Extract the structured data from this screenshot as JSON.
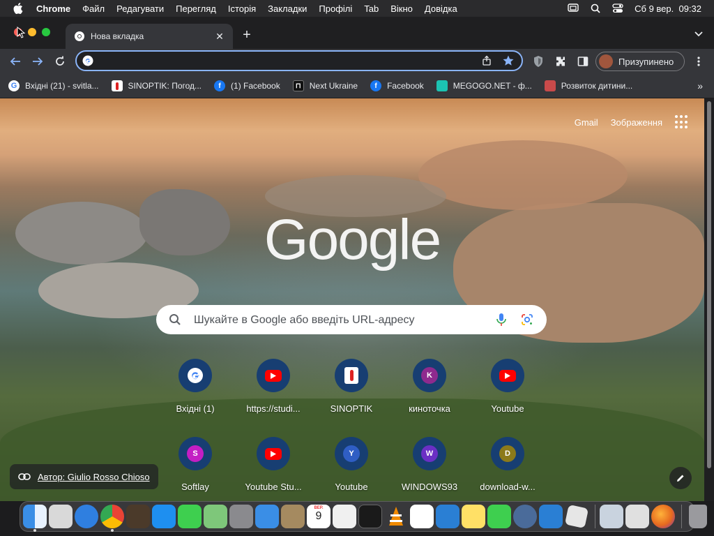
{
  "menubar": {
    "app_name": "Chrome",
    "items": [
      "Файл",
      "Редагувати",
      "Перегляд",
      "Історія",
      "Закладки",
      "Профілі",
      "Tab",
      "Вікно",
      "Довідка"
    ],
    "datetime": "Сб 9 вер.  09:32"
  },
  "tab": {
    "title": "Нова вкладка"
  },
  "omnibox": {
    "value": ""
  },
  "profile": {
    "label": "Призупинено"
  },
  "bookmarks": [
    {
      "label": "Вхідні (21) - svitla...",
      "icon": "google-icon",
      "color": "#ffffff"
    },
    {
      "label": "SINOPTIK: Погод...",
      "icon": "thermometer-icon",
      "color": "#ffffff"
    },
    {
      "label": "(1) Facebook",
      "icon": "facebook-icon",
      "color": "#1877f2"
    },
    {
      "label": "Next Ukraine",
      "icon": "next-ukraine-icon",
      "color": "#111111"
    },
    {
      "label": "Facebook",
      "icon": "facebook-icon",
      "color": "#1877f2"
    },
    {
      "label": "MEGOGO.NET - ф...",
      "icon": "megogo-icon",
      "color": "#1cc3b2"
    },
    {
      "label": "Розвиток дитини...",
      "icon": "child-dev-icon",
      "color": "#c94a4a"
    }
  ],
  "ntp": {
    "top_links": {
      "gmail": "Gmail",
      "images": "Зображення"
    },
    "logo_text": "Google",
    "search_placeholder": "Шукайте в Google або введіть URL-адресу",
    "shortcuts_row1": [
      {
        "label": "Вхідні (1)",
        "icon": "google-icon",
        "letter": ""
      },
      {
        "label": "https://studi...",
        "icon": "youtube-icon",
        "letter": ""
      },
      {
        "label": "SINOPTIK",
        "icon": "thermometer-icon",
        "letter": ""
      },
      {
        "label": "киноточка",
        "icon": "letter-icon",
        "letter": "K",
        "color": "#8e2a8e"
      },
      {
        "label": "Youtube",
        "icon": "youtube-icon",
        "letter": ""
      }
    ],
    "shortcuts_row2": [
      {
        "label": "Softlay",
        "icon": "letter-icon",
        "letter": "S",
        "color": "#c41ec4"
      },
      {
        "label": "Youtube Stu...",
        "icon": "youtube-icon",
        "letter": ""
      },
      {
        "label": "Youtube",
        "icon": "letter-icon",
        "letter": "Y",
        "color": "#2f5ec4"
      },
      {
        "label": "WINDOWS93",
        "icon": "letter-icon",
        "letter": "W",
        "color": "#6b2fc4"
      },
      {
        "label": "download-w...",
        "icon": "letter-icon",
        "letter": "D",
        "color": "#8c7a1a"
      }
    ],
    "author": "Автор: Giulio Rosso Chioso"
  },
  "dock": {
    "apps": [
      {
        "name": "finder-icon",
        "color": "#3a8ee6"
      },
      {
        "name": "launchpad-icon",
        "color": "#d9d9d9"
      },
      {
        "name": "safari-icon",
        "color": "#2f7fe0"
      },
      {
        "name": "chrome-icon",
        "color": "#ffffff"
      },
      {
        "name": "garageband-icon",
        "color": "#4b3a2a"
      },
      {
        "name": "app-store-icon",
        "color": "#1e8ff0"
      },
      {
        "name": "messages-icon",
        "color": "#3ecf4f"
      },
      {
        "name": "maps-icon",
        "color": "#7ec77a"
      },
      {
        "name": "system-settings-icon",
        "color": "#8a8a8e"
      },
      {
        "name": "mail-icon",
        "color": "#3a8ee6"
      },
      {
        "name": "contacts-icon",
        "color": "#a58a60"
      },
      {
        "name": "calendar-icon",
        "color": "#ffffff"
      },
      {
        "name": "textedit-icon",
        "color": "#f0f0f0"
      },
      {
        "name": "terminal-icon",
        "color": "#1a1a1a"
      },
      {
        "name": "vlc-icon",
        "color": "#f08a00"
      },
      {
        "name": "reminders-icon",
        "color": "#ffffff"
      },
      {
        "name": "vscode-icon",
        "color": "#2a7fd4"
      },
      {
        "name": "notes-icon",
        "color": "#ffe066"
      },
      {
        "name": "facetime-icon",
        "color": "#3ecf4f"
      },
      {
        "name": "quicktime-icon",
        "color": "#4a6b9a"
      },
      {
        "name": "window-app-icon",
        "color": "#2a7fd4"
      },
      {
        "name": "roblox-icon",
        "color": "#e6e6e6"
      },
      {
        "name": "screen-app-icon",
        "color": "#c9d3df"
      },
      {
        "name": "utility-app-icon",
        "color": "#e0e0e0"
      },
      {
        "name": "firefox-icon",
        "color": "#e66a1f"
      },
      {
        "name": "trash-icon",
        "color": "#9a9a9e"
      }
    ],
    "calendar_month": "ВЕР.",
    "calendar_day": "9"
  }
}
